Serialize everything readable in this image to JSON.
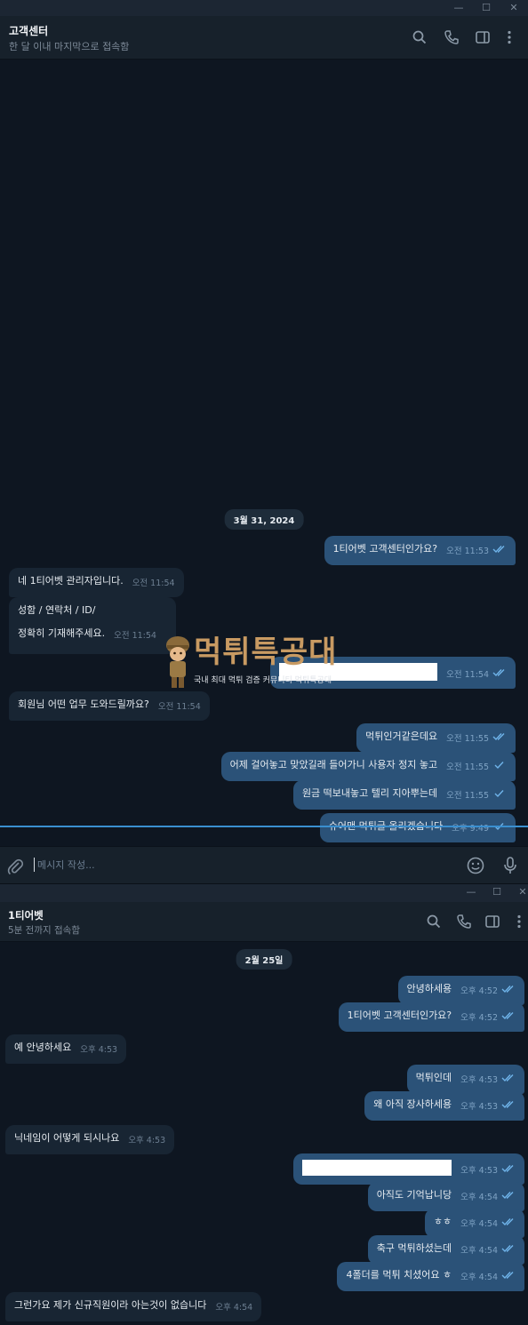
{
  "window1": {
    "header": {
      "title": "고객센터",
      "subtitle": "한 달 이내 마지막으로 접속함"
    },
    "date_badge": "3월 31, 2024",
    "messages": [
      {
        "dir": "out",
        "text": "1티어벳 고객센터인가요?",
        "time": "오전 11:53",
        "check": "double"
      },
      {
        "dir": "in",
        "text": "네 1티어벳 관리자입니다.",
        "time": "오전 11:54"
      },
      {
        "dir": "in",
        "line1": "성함 / 연락처 / ID/",
        "line2": "정확히 기재해주세요.",
        "time": "오전 11:54"
      },
      {
        "dir": "out",
        "text": "",
        "time": "오전 11:54",
        "check": "double",
        "redacted": true
      },
      {
        "dir": "in",
        "text": "회원님 어떤 업무 도와드릴까요?",
        "time": "오전 11:54"
      },
      {
        "dir": "out",
        "text": "먹튀인거같은데요",
        "time": "오전 11:55",
        "check": "double"
      },
      {
        "dir": "out",
        "text": "어제 걸어놓고 맞았길래 들어가니 사용자 정지 놓고",
        "time": "오전 11:55",
        "check": "single"
      },
      {
        "dir": "out",
        "text": "원금 떡보내놓고 텔리 지아뿌는데",
        "time": "오전 11:55",
        "check": "single"
      },
      {
        "dir": "out",
        "text": "슈어맨 먹튀글 올리겠습니다",
        "time": "오후 9:49",
        "check": "single"
      }
    ],
    "composer_placeholder": "메시지 작성...",
    "watermark": {
      "brand": "먹튀특공대",
      "tagline": "국내 최대 먹튀 검증 커뮤니티 먹튀특공대"
    }
  },
  "window2": {
    "header": {
      "title": "1티어벳",
      "subtitle": "5분 전까지 접속함"
    },
    "date_badge": "2월 25일",
    "messages": [
      {
        "dir": "out",
        "text": "안녕하세용",
        "time": "오후 4:52",
        "check": "double"
      },
      {
        "dir": "out",
        "text": "1티어벳 고객센터인가요?",
        "time": "오후 4:52",
        "check": "double"
      },
      {
        "dir": "in",
        "text": "예 안녕하세요",
        "time": "오후 4:53"
      },
      {
        "dir": "out",
        "text": "먹튀인데",
        "time": "오후 4:53",
        "check": "double"
      },
      {
        "dir": "out",
        "text": "왜 아직 장사하세용",
        "time": "오후 4:53",
        "check": "double"
      },
      {
        "dir": "in",
        "text": "닉네임이 어떻게 되시나요",
        "time": "오후 4:53"
      },
      {
        "dir": "out",
        "text": "",
        "time": "오후 4:53",
        "check": "double",
        "redacted": true
      },
      {
        "dir": "out",
        "text": "아직도 기억납니당",
        "time": "오후 4:54",
        "check": "double"
      },
      {
        "dir": "out",
        "text": "ㅎㅎ",
        "time": "오후 4:54",
        "check": "double"
      },
      {
        "dir": "out",
        "text": "축구 먹튀하셨는데",
        "time": "오후 4:54",
        "check": "double"
      },
      {
        "dir": "out",
        "text": "4폴더를 먹튀 치셨어요 ㅎ",
        "time": "오후 4:54",
        "check": "double"
      },
      {
        "dir": "in",
        "text": "그런가요 제가 신규직원이라 아는것이 없습니다",
        "time": "오후 4:54"
      }
    ]
  },
  "colors": {
    "bg": "#0e1621",
    "header": "#17212b",
    "bubble_in": "#182533",
    "bubble_out": "#2b5278",
    "accent": "#3a8fd0"
  },
  "icons": [
    "minimize-icon",
    "maximize-icon",
    "close-icon",
    "search-icon",
    "phone-icon",
    "sidebar-toggle-icon",
    "more-vertical-icon",
    "attach-icon",
    "emoji-icon",
    "microphone-icon",
    "double-check-icon",
    "single-check-icon"
  ]
}
